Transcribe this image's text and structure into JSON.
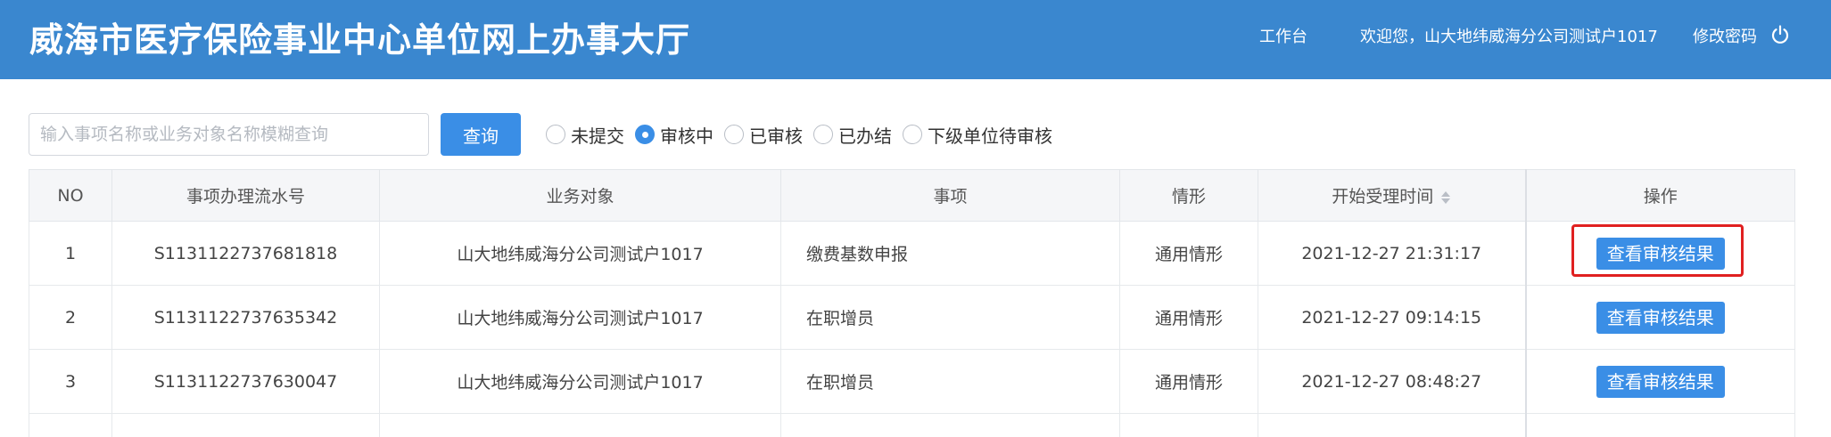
{
  "header": {
    "title": "威海市医疗保险事业中心单位网上办事大厅",
    "workbench": "工作台",
    "welcome": "欢迎您，山大地纬威海分公司测试户1017",
    "change_password": "修改密码",
    "power_icon": "power-icon"
  },
  "toolbar": {
    "search_placeholder": "输入事项名称或业务对象名称模糊查询",
    "search_value": "",
    "search_button": "查询",
    "filters": [
      {
        "label": "未提交",
        "checked": false
      },
      {
        "label": "审核中",
        "checked": true
      },
      {
        "label": "已审核",
        "checked": false
      },
      {
        "label": "已办结",
        "checked": false
      },
      {
        "label": "下级单位待审核",
        "checked": false
      }
    ]
  },
  "table": {
    "columns": [
      "NO",
      "事项办理流水号",
      "业务对象",
      "事项",
      "情形",
      "开始受理时间",
      "操作"
    ],
    "rows": [
      {
        "no": "1",
        "serial": "S1131122737681818",
        "object": "山大地纬威海分公司测试户1017",
        "item": "缴费基数申报",
        "situation": "通用情形",
        "start_time": "2021-12-27 21:31:17",
        "action": "查看审核结果"
      },
      {
        "no": "2",
        "serial": "S1131122737635342",
        "object": "山大地纬威海分公司测试户1017",
        "item": "在职增员",
        "situation": "通用情形",
        "start_time": "2021-12-27 09:14:15",
        "action": "查看审核结果"
      },
      {
        "no": "3",
        "serial": "S1131122737630047",
        "object": "山大地纬威海分公司测试户1017",
        "item": "在职增员",
        "situation": "通用情形",
        "start_time": "2021-12-27 08:48:27",
        "action": "查看审核结果"
      }
    ]
  },
  "colors": {
    "header_bg": "#3a87cf",
    "primary": "#3a8ee6",
    "highlight": "#e02020"
  }
}
